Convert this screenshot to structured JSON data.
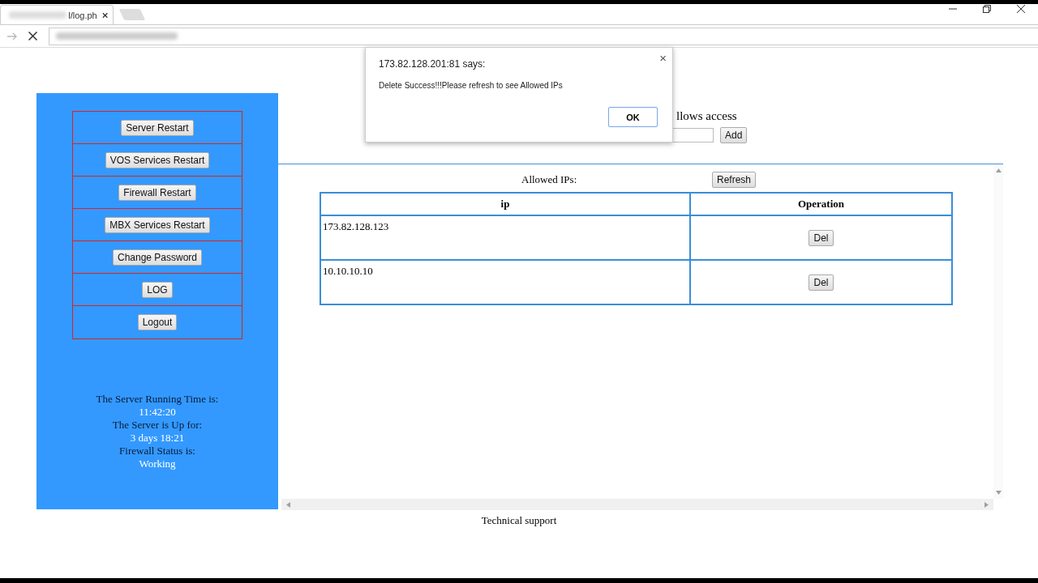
{
  "browser": {
    "tab": {
      "title": "l/log.ph",
      "selected": true
    }
  },
  "sidebar": {
    "buttons": [
      {
        "label": "Server Restart"
      },
      {
        "label": "VOS Services Restart"
      },
      {
        "label": "Firewall Restart"
      },
      {
        "label": "MBX Services Restart"
      },
      {
        "label": "Change Password"
      },
      {
        "label": "LOG"
      },
      {
        "label": "Logout"
      }
    ],
    "status": [
      {
        "label": "The Server Running Time is:",
        "value": "11:42:20"
      },
      {
        "label": "The Server is Up for:",
        "value": "3 days 18:21"
      },
      {
        "label": "Firewall Status is:",
        "value": "Working"
      }
    ]
  },
  "access": {
    "text": "llows access",
    "add_button": "Add"
  },
  "allowed_ips": {
    "label": "Allowed IPs:",
    "refresh_button": "Refresh",
    "columns": [
      "ip",
      "Operation"
    ],
    "rows": [
      {
        "ip": "173.82.128.123",
        "action": "Del"
      },
      {
        "ip": "10.10.10.10",
        "action": "Del"
      }
    ]
  },
  "footer": "Technical support",
  "dialog": {
    "title": "173.82.128.201:81 says:",
    "message": "Delete Success!!!Please refresh to see Allowed IPs",
    "ok_button": "OK",
    "close": "×"
  }
}
